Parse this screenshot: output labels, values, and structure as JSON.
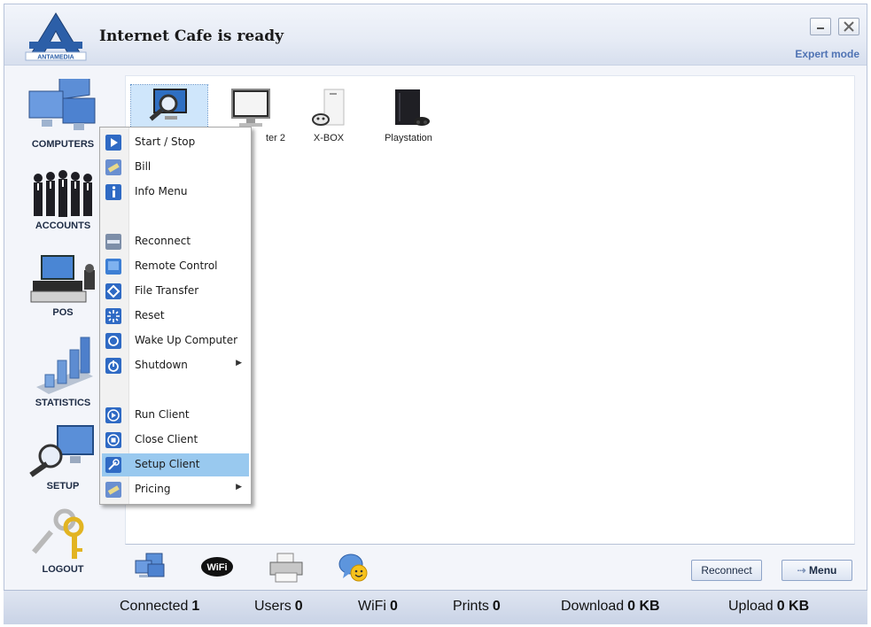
{
  "window": {
    "title": "Internet Cafe is ready",
    "logo_text": "ANTAMEDIA",
    "expert_mode": "Expert mode"
  },
  "sidebar": {
    "items": [
      {
        "label": "COMPUTERS",
        "icon": "computers-icon"
      },
      {
        "label": "ACCOUNTS",
        "icon": "accounts-icon"
      },
      {
        "label": "POS",
        "icon": "pos-icon"
      },
      {
        "label": "STATISTICS",
        "icon": "statistics-icon"
      },
      {
        "label": "SETUP",
        "icon": "setup-icon"
      },
      {
        "label": "LOGOUT",
        "icon": "keys-icon"
      }
    ]
  },
  "devices": [
    {
      "label": "",
      "icon": "computer-magnifier-icon",
      "selected": true
    },
    {
      "label": "ter 2",
      "icon": "monitor-icon"
    },
    {
      "label": "X-BOX",
      "icon": "xbox-icon"
    },
    {
      "label": "Playstation",
      "icon": "playstation-icon"
    }
  ],
  "context_menu": {
    "items": [
      {
        "label": "Start / Stop",
        "icon": "play-icon"
      },
      {
        "label": "Bill",
        "icon": "bill-icon"
      },
      {
        "label": "Info Menu",
        "icon": "info-icon"
      },
      {
        "label": "Reconnect",
        "icon": "reconnect-icon"
      },
      {
        "label": "Remote Control",
        "icon": "remote-control-icon"
      },
      {
        "label": "File Transfer",
        "icon": "file-transfer-icon"
      },
      {
        "label": "Reset",
        "icon": "reset-icon"
      },
      {
        "label": "Wake Up Computer",
        "icon": "wake-up-icon"
      },
      {
        "label": "Shutdown",
        "icon": "shutdown-icon",
        "submenu": true
      },
      {
        "label": "Run Client",
        "icon": "run-client-icon"
      },
      {
        "label": "Close Client",
        "icon": "close-client-icon"
      },
      {
        "label": "Setup Client",
        "icon": "setup-client-icon",
        "highlighted": true
      },
      {
        "label": "Pricing",
        "icon": "pricing-icon",
        "submenu": true
      }
    ]
  },
  "toolbar": {
    "icons": [
      "computers-small-icon",
      "wifi-icon",
      "printer-icon",
      "chat-icon"
    ],
    "wifi_text": "WiFi",
    "reconnect_label": "Reconnect",
    "menu_label": "Menu"
  },
  "status": {
    "connected_label": "Connected",
    "connected_value": "1",
    "users_label": "Users",
    "users_value": "0",
    "wifi_label": "WiFi",
    "wifi_value": "0",
    "prints_label": "Prints",
    "prints_value": "0",
    "download_label": "Download",
    "download_value": "0 KB",
    "upload_label": "Upload",
    "upload_value": "0 KB"
  },
  "colors": {
    "accent": "#4f73b4",
    "menu_highlight": "#99c9ef",
    "statusbar": "#c9d3e6"
  }
}
